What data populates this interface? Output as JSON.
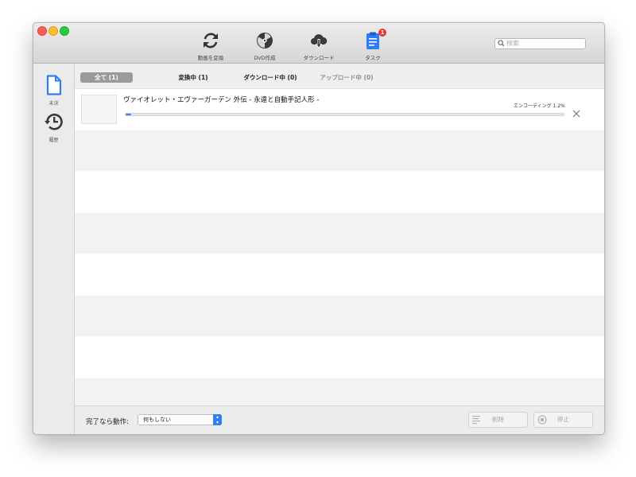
{
  "toolbar": {
    "items": [
      {
        "label": "動画を変換",
        "icon": "convert-icon"
      },
      {
        "label": "DVD作成",
        "icon": "dvd-burn-icon"
      },
      {
        "label": "ダウンロード",
        "icon": "download-cloud-icon"
      },
      {
        "label": "タスク",
        "icon": "task-list-icon",
        "badge": "1"
      }
    ],
    "search_placeholder": "検索"
  },
  "sidebar": {
    "items": [
      {
        "label": "未決",
        "icon": "document-icon"
      },
      {
        "label": "履歴",
        "icon": "history-icon"
      }
    ]
  },
  "tabs": [
    {
      "label": "全て (1)",
      "active": true
    },
    {
      "label": "変換中 (1)",
      "active": false
    },
    {
      "label": "ダウンロード中 (0)",
      "active": false
    },
    {
      "label": "アップロード中 (0)",
      "active": false
    }
  ],
  "tasks": [
    {
      "title": "ヴァイオレット・エヴァーガーデン 外伝 - 永遠と自動手記人形 -",
      "status": "エンコーディング 1.2%",
      "progress": 0.012
    }
  ],
  "footer": {
    "completion_label": "完了なら動作:",
    "completion_value": "何もしない",
    "delete_label": "削除",
    "stop_label": "停止"
  },
  "colors": {
    "accent": "#2e7cf6",
    "badge": "#e8372c",
    "active_tab": "#9a9a9a"
  }
}
